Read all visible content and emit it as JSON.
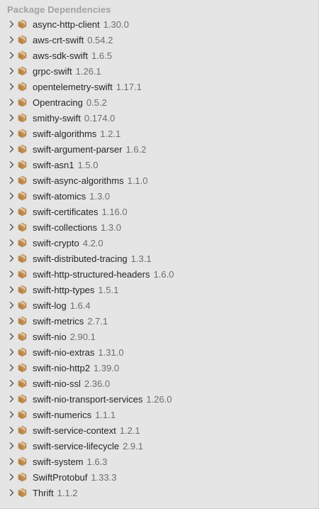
{
  "section_title": "Package Dependencies",
  "colors": {
    "background": "#e5e5e5",
    "package_icon": "#b98445",
    "version_text": "#6e6e6e",
    "header_text": "#a2a2a2"
  },
  "icons": {
    "disclosure": "chevron-right-icon",
    "package": "package-box-icon"
  },
  "packages": [
    {
      "name": "async-http-client",
      "version": "1.30.0"
    },
    {
      "name": "aws-crt-swift",
      "version": "0.54.2"
    },
    {
      "name": "aws-sdk-swift",
      "version": "1.6.5"
    },
    {
      "name": "grpc-swift",
      "version": "1.26.1"
    },
    {
      "name": "opentelemetry-swift",
      "version": "1.17.1"
    },
    {
      "name": "Opentracing",
      "version": "0.5.2"
    },
    {
      "name": "smithy-swift",
      "version": "0.174.0"
    },
    {
      "name": "swift-algorithms",
      "version": "1.2.1"
    },
    {
      "name": "swift-argument-parser",
      "version": "1.6.2"
    },
    {
      "name": "swift-asn1",
      "version": "1.5.0"
    },
    {
      "name": "swift-async-algorithms",
      "version": "1.1.0"
    },
    {
      "name": "swift-atomics",
      "version": "1.3.0"
    },
    {
      "name": "swift-certificates",
      "version": "1.16.0"
    },
    {
      "name": "swift-collections",
      "version": "1.3.0"
    },
    {
      "name": "swift-crypto",
      "version": "4.2.0"
    },
    {
      "name": "swift-distributed-tracing",
      "version": "1.3.1"
    },
    {
      "name": "swift-http-structured-headers",
      "version": "1.6.0"
    },
    {
      "name": "swift-http-types",
      "version": "1.5.1"
    },
    {
      "name": "swift-log",
      "version": "1.6.4"
    },
    {
      "name": "swift-metrics",
      "version": "2.7.1"
    },
    {
      "name": "swift-nio",
      "version": "2.90.1"
    },
    {
      "name": "swift-nio-extras",
      "version": "1.31.0"
    },
    {
      "name": "swift-nio-http2",
      "version": "1.39.0"
    },
    {
      "name": "swift-nio-ssl",
      "version": "2.36.0"
    },
    {
      "name": "swift-nio-transport-services",
      "version": "1.26.0"
    },
    {
      "name": "swift-numerics",
      "version": "1.1.1"
    },
    {
      "name": "swift-service-context",
      "version": "1.2.1"
    },
    {
      "name": "swift-service-lifecycle",
      "version": "2.9.1"
    },
    {
      "name": "swift-system",
      "version": "1.6.3"
    },
    {
      "name": "SwiftProtobuf",
      "version": "1.33.3"
    },
    {
      "name": "Thrift",
      "version": "1.1.2"
    }
  ]
}
